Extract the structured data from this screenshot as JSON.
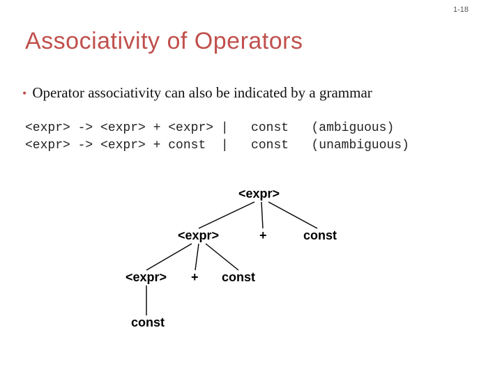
{
  "page_number": "1-18",
  "title": "Associativity of Operators",
  "bullet": "Operator associativity can also be indicated by a grammar",
  "grammar_line1": "<expr> -> <expr> + <expr> |   const   (ambiguous)",
  "grammar_line2": "<expr> -> <expr> + const  |   const   (unambiguous)",
  "tree": {
    "n_root": "<expr>",
    "n_l1_expr": "<expr>",
    "n_l1_plus": "+",
    "n_l1_const": "const",
    "n_l2_expr": "<expr>",
    "n_l2_plus": "+",
    "n_l2_const": "const",
    "n_l3_const": "const"
  }
}
